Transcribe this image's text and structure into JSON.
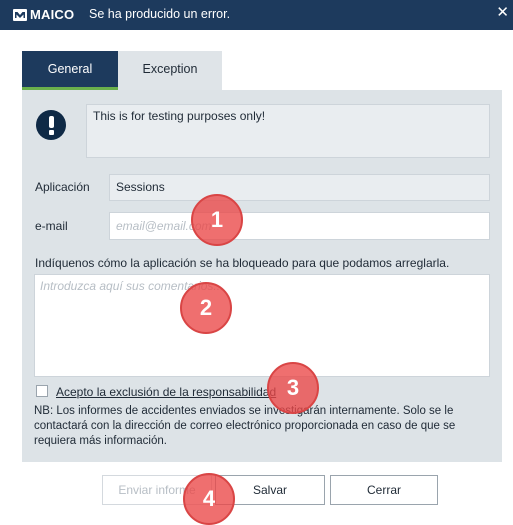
{
  "window": {
    "brand": "MAICO",
    "title": "Se ha producido un error.",
    "close_label": "✕"
  },
  "tabs": [
    {
      "label": "General",
      "active": true
    },
    {
      "label": "Exception",
      "active": false
    }
  ],
  "error": {
    "message": "This is for testing purposes only!"
  },
  "form": {
    "app_label": "Aplicación",
    "app_value": "Sessions",
    "email_label": "e-mail",
    "email_placeholder": "email@email.com",
    "comments_hint": "Indíquenos cómo la aplicación se ha bloqueado para que podamos arreglarla.",
    "comments_placeholder": "Introduzca aquí sus comentarios...",
    "disclaimer_label": "Acepto la exclusión de la responsabilidad",
    "disclaimer_checked": false,
    "note": "NB: Los informes de accidentes enviados se investigarán internamente. Solo se le contactará con la dirección de correo electrónico proporcionada en caso de que se requiera más información."
  },
  "buttons": {
    "send": "Enviar informe",
    "save": "Salvar",
    "close": "Cerrar"
  },
  "annotations": [
    "1",
    "2",
    "3",
    "4"
  ],
  "colors": {
    "titlebar": "#1d3a5d",
    "tab_active_underline": "#6ab04c",
    "panel": "#dde3e7",
    "badge": "#eb4646"
  }
}
